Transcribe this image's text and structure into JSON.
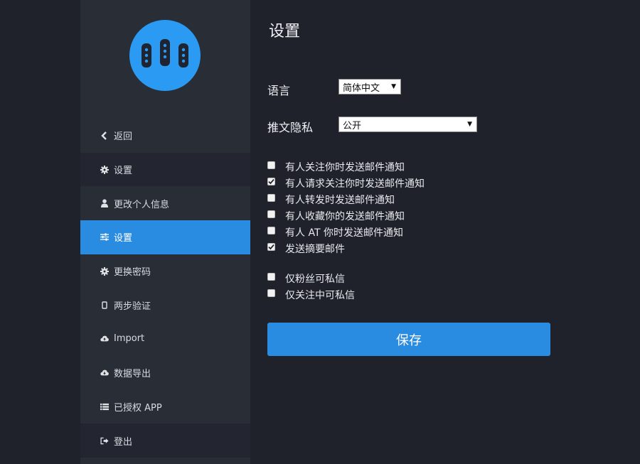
{
  "colors": {
    "background": "#1f222b",
    "sidebar": "#292d36",
    "accent": "#2a8ce0",
    "logo": "#2b9af3"
  },
  "sidebar": {
    "items": [
      {
        "label": "返回",
        "icon": "chevron-left-icon"
      },
      {
        "label": "设置",
        "icon": "gear-icon"
      },
      {
        "label": "更改个人信息",
        "icon": "user-icon"
      },
      {
        "label": "设置",
        "icon": "sliders-icon",
        "active": true
      },
      {
        "label": "更换密码",
        "icon": "gear-icon"
      },
      {
        "label": "两步验证",
        "icon": "phone-icon"
      },
      {
        "label": "Import",
        "icon": "cloud-icon"
      },
      {
        "label": "数据导出",
        "icon": "cloud-icon"
      },
      {
        "label": "已授权 APP",
        "icon": "list-icon"
      },
      {
        "label": "登出",
        "icon": "sign-out-icon"
      }
    ]
  },
  "main": {
    "title": "设置",
    "language": {
      "label": "语言",
      "value": "简体中文"
    },
    "privacy": {
      "label": "推文隐私",
      "value": "公开"
    },
    "notifications": [
      {
        "label": "有人关注你时发送邮件通知",
        "checked": false
      },
      {
        "label": "有人请求关注你时发送邮件通知",
        "checked": true
      },
      {
        "label": "有人转发时发送邮件通知",
        "checked": false
      },
      {
        "label": "有人收藏你的发送邮件通知",
        "checked": false
      },
      {
        "label": "有人 AT 你时发送邮件通知",
        "checked": false
      },
      {
        "label": "发送摘要邮件",
        "checked": true
      }
    ],
    "messaging": [
      {
        "label": "仅粉丝可私信",
        "checked": false
      },
      {
        "label": "仅关注中可私信",
        "checked": false
      }
    ],
    "save_label": "保存"
  }
}
